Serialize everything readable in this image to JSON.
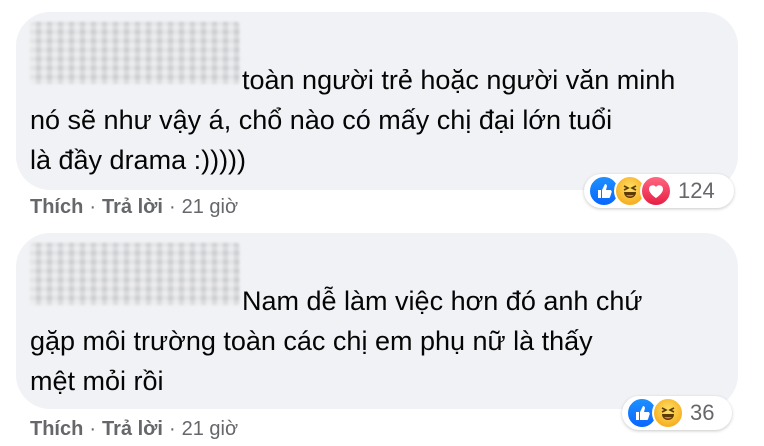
{
  "comments": [
    {
      "lines": [
        "toàn người trẻ hoặc người văn minh",
        "nó sẽ như vậy á, chổ nào có mấy chị đại lớn tuổi",
        "là đầy drama :)))))"
      ],
      "reactions": [
        "like",
        "haha",
        "love"
      ],
      "reaction_count": "124",
      "like_label": "Thích",
      "reply_label": "Trả lời",
      "separator": "·",
      "time": "21 giờ"
    },
    {
      "lines": [
        "Nam dễ làm việc hơn đó anh chứ",
        "gặp môi trường toàn các chị em phụ nữ là thấy",
        "mệt mỏi rồi"
      ],
      "reactions": [
        "like",
        "haha"
      ],
      "reaction_count": "36",
      "like_label": "Thích",
      "reply_label": "Trả lời",
      "separator": "·",
      "time": "21 giờ"
    }
  ],
  "colors": {
    "bubble": "#f0f2f5",
    "text": "#050505",
    "meta": "#65676b",
    "like": "#0866ff",
    "haha": "#f7b125",
    "love": "#e61e45"
  }
}
